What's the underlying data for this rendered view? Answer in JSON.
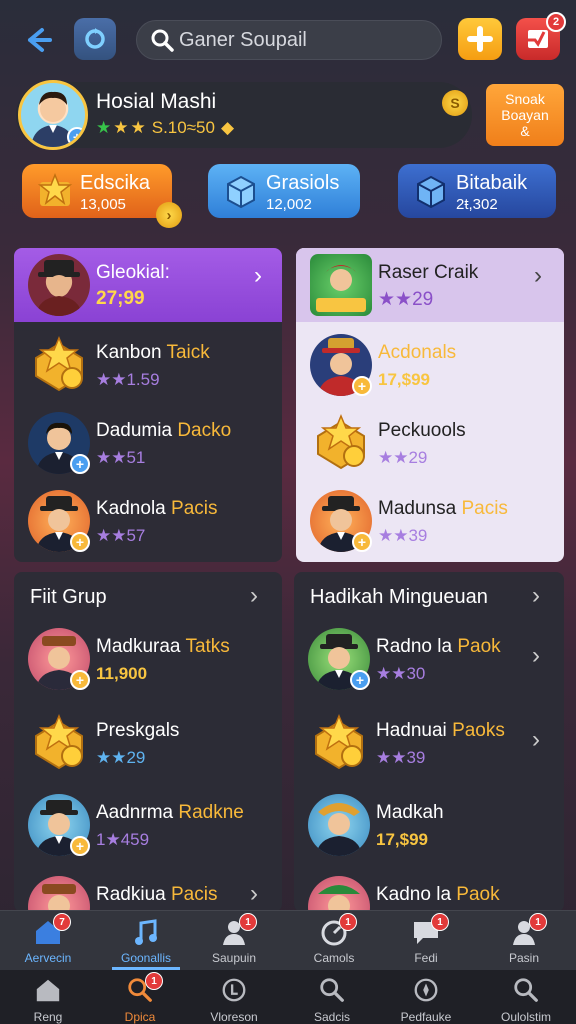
{
  "search": {
    "placeholder": "Ganer Soupail"
  },
  "header": {
    "notification_count": "2"
  },
  "profile": {
    "name": "Hosial Mashi",
    "coins": "S.10≈50",
    "coin_symbol": "S"
  },
  "snack_button": {
    "line1": "Snoak",
    "line2": "Boayan",
    "line3": "&"
  },
  "currencies": [
    {
      "label": "Edscika",
      "value": "13,005"
    },
    {
      "label": "Grasiols",
      "value": "12,002"
    },
    {
      "label": "Bitabaik",
      "value": "2ŧ,302"
    }
  ],
  "featured_left": {
    "title": "Gleokial:",
    "value": "27;99",
    "rows": [
      {
        "name_a": "Kanbon ",
        "name_b": "Taick",
        "sub": "★★1.59"
      },
      {
        "name_a": "Dadumia ",
        "name_b": "Dacko",
        "sub": "★★51"
      },
      {
        "name_a": "Kadnola ",
        "name_b": "Pacis",
        "sub": "★★57"
      }
    ]
  },
  "featured_right": {
    "title": "Raser Craik",
    "value": "★★29",
    "rows": [
      {
        "name_a": "",
        "name_b": "Acdonals",
        "sub": "17,$99"
      },
      {
        "name_a": "Peckuools",
        "name_b": "",
        "sub": "★★29"
      },
      {
        "name_a": "Madunsa ",
        "name_b": "Pacis",
        "sub": "★★39"
      }
    ]
  },
  "group_left": {
    "title": "Fiit Grup",
    "rows": [
      {
        "name_a": "Madkuraa ",
        "name_b": "Tatks",
        "sub": "11,900"
      },
      {
        "name_a": "Preskgals",
        "name_b": "",
        "sub": "★★29"
      },
      {
        "name_a": "Aadnrma ",
        "name_b": "Radkne",
        "sub": "1★459"
      },
      {
        "name_a": "Radkiua ",
        "name_b": "Pacis",
        "sub": ""
      }
    ]
  },
  "group_right": {
    "title": "Hadikah Mingueuan",
    "rows": [
      {
        "name_a": "Radno la ",
        "name_b": "Paok",
        "sub": "★★30"
      },
      {
        "name_a": "Hadnuai ",
        "name_b": "Paoks",
        "sub": "★★39"
      },
      {
        "name_a": "Madkah",
        "name_b": "",
        "sub": "17,$99"
      },
      {
        "name_a": "Kadno la ",
        "name_b": "Paok",
        "sub": ""
      }
    ]
  },
  "nav_top": [
    {
      "label": "Aervecin",
      "badge": "7"
    },
    {
      "label": "Goonallis",
      "badge": ""
    },
    {
      "label": "Saupuin",
      "badge": "1"
    },
    {
      "label": "Camols",
      "badge": "1"
    },
    {
      "label": "Fedi",
      "badge": "1"
    },
    {
      "label": "Pasin",
      "badge": "1"
    }
  ],
  "nav_bottom": [
    {
      "label": "Reng",
      "badge": ""
    },
    {
      "label": "Dpica",
      "badge": "1"
    },
    {
      "label": "Vloreson",
      "badge": ""
    },
    {
      "label": "Sadcis",
      "badge": ""
    },
    {
      "label": "Pedfauke",
      "badge": ""
    },
    {
      "label": "Oulolstim",
      "badge": ""
    }
  ],
  "colors": {
    "accent": "#f8c541",
    "purple": "#8a42d4",
    "nav_active": "#6cb6ff"
  }
}
